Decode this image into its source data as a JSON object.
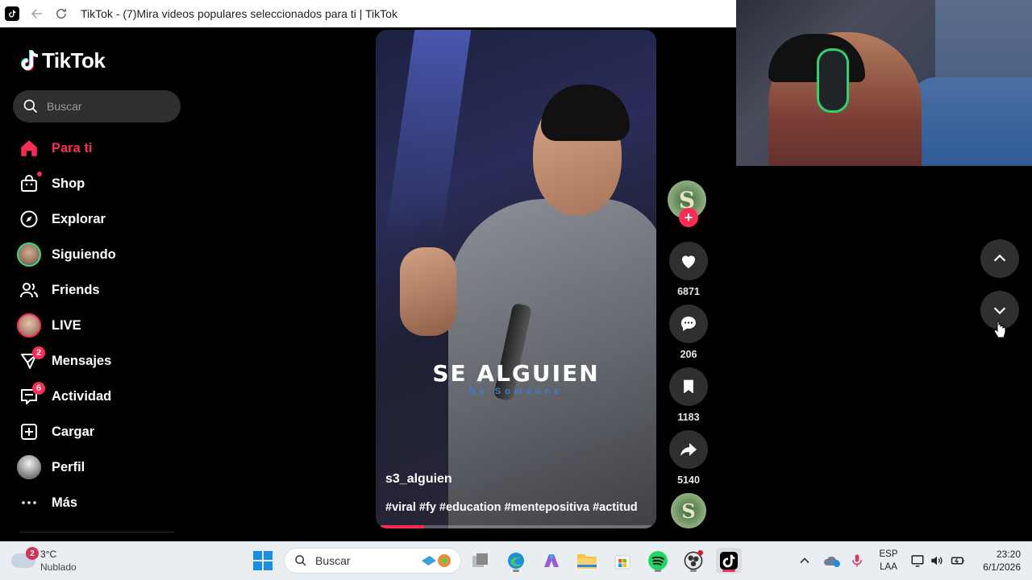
{
  "window": {
    "title": "TikTok - (7)Mira videos populares seleccionados para ti | TikTok"
  },
  "sidebar": {
    "logo": "TikTok",
    "search_placeholder": "Buscar",
    "items": [
      {
        "label": "Para ti",
        "icon": "home-icon",
        "active": true
      },
      {
        "label": "Shop",
        "icon": "shop-bag-icon"
      },
      {
        "label": "Explorar",
        "icon": "compass-icon"
      },
      {
        "label": "Siguiendo",
        "icon": "following-avatar"
      },
      {
        "label": "Friends",
        "icon": "friends-icon"
      },
      {
        "label": "LIVE",
        "icon": "live-avatar"
      },
      {
        "label": "Mensajes",
        "icon": "messages-icon",
        "badge": "2"
      },
      {
        "label": "Actividad",
        "icon": "activity-icon",
        "badge": "6"
      },
      {
        "label": "Cargar",
        "icon": "upload-icon"
      },
      {
        "label": "Perfil",
        "icon": "profile-avatar"
      },
      {
        "label": "Más",
        "icon": "more-icon"
      }
    ]
  },
  "video": {
    "overlay_title": "SE ALGUIEN",
    "overlay_subtitle": "Be Someone",
    "author": "s3_alguien",
    "hashtags": "#viral #fy #education #mentepositiva #actitud",
    "progress": 0.16
  },
  "actions": {
    "author_avatar_letter": "S",
    "likes": "6871",
    "comments": "206",
    "saves": "1183",
    "shares": "5140"
  },
  "taskbar": {
    "weather_badge": "2",
    "temperature": "3°C",
    "condition": "Nublado",
    "search_label": "Buscar",
    "lang_line1": "ESP",
    "lang_line2": "LAA",
    "time": "23:20",
    "date": "6/1/2026"
  },
  "colors": {
    "accent": "#fe2c55",
    "background": "#000000",
    "button_bg": "#2f2f2f"
  }
}
